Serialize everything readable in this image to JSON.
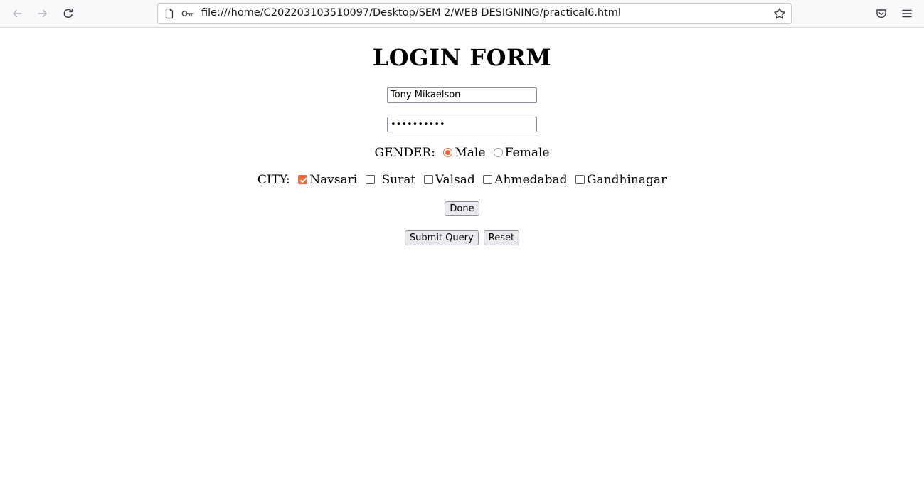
{
  "browser": {
    "url": "file:///home/C202203103510097/Desktop/SEM 2/WEB DESIGNING/practical6.html"
  },
  "form": {
    "title": "LOGIN FORM",
    "username_value": "Tony Mikaelson",
    "password_value": "••••••••••",
    "gender_label": "GENDER:",
    "gender_options": [
      {
        "label": "Male",
        "checked": true
      },
      {
        "label": "Female",
        "checked": false
      }
    ],
    "city_label": "CITY:",
    "city_options": [
      {
        "label": "Navsari",
        "checked": true
      },
      {
        "label": "Surat",
        "checked": false
      },
      {
        "label": "Valsad",
        "checked": false
      },
      {
        "label": "Ahmedabad",
        "checked": false
      },
      {
        "label": "Gandhinagar",
        "checked": false
      }
    ],
    "done_label": "Done",
    "submit_label": "Submit Query",
    "reset_label": "Reset"
  },
  "colors": {
    "accent": "#e66c3d",
    "toolbar_bg": "#f9f9fb"
  }
}
